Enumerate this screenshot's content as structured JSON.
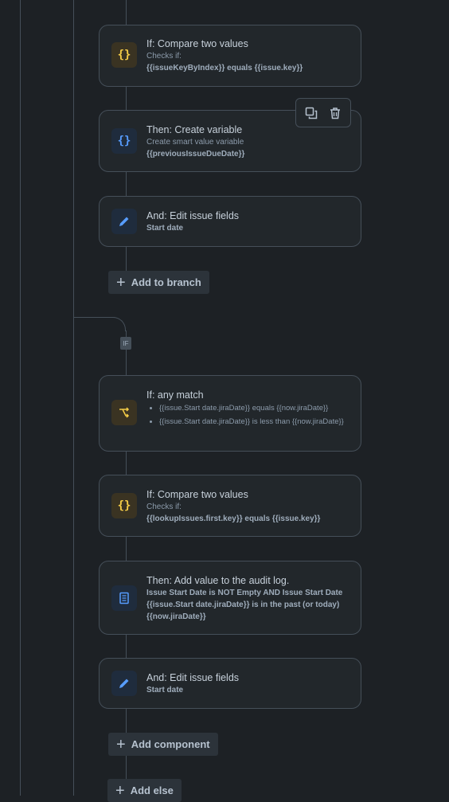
{
  "colors": {
    "background": "#1d2125",
    "card": "#22272b",
    "border": "#454f59",
    "yellow_icon": "#f5cd47",
    "blue_icon": "#579dff"
  },
  "cards": [
    {
      "icon": "curly-braces-icon",
      "title": "If: Compare two values",
      "sub": "Checks if:",
      "detail": "{{issueKeyByIndex}} equals {{issue.key}}"
    },
    {
      "icon": "curly-braces-icon",
      "title": "Then: Create variable",
      "sub": "Create smart value variable",
      "detail": "{{previousIssueDueDate}}"
    },
    {
      "icon": "pencil-icon",
      "title": "And: Edit issue fields",
      "detail": "Start date"
    },
    {
      "icon": "branch-icon",
      "title": "If: any match",
      "bullets": [
        "{{issue.Start date.jiraDate}} equals {{now.jiraDate}}",
        "{{issue.Start date.jiraDate}} is less than {{now.jiraDate}}"
      ]
    },
    {
      "icon": "curly-braces-icon",
      "title": "If: Compare two values",
      "sub": "Checks if:",
      "detail": "{{lookupIssues.first.key}} equals {{issue.key}}"
    },
    {
      "icon": "document-icon",
      "title": "Then: Add value to the audit log.",
      "detail": "Issue Start Date is NOT Empty AND Issue Start Date {{issue.Start date.jiraDate}} is in the past (or today) {{now.jiraDate}}"
    },
    {
      "icon": "pencil-icon",
      "title": "And: Edit issue fields",
      "detail": "Start date"
    }
  ],
  "buttons": {
    "add_to_branch": "Add to branch",
    "add_component": "Add component",
    "add_else": "Add else"
  },
  "if_label": "IF",
  "toolbar": {
    "duplicate": "copy-icon",
    "delete": "trash-icon"
  }
}
